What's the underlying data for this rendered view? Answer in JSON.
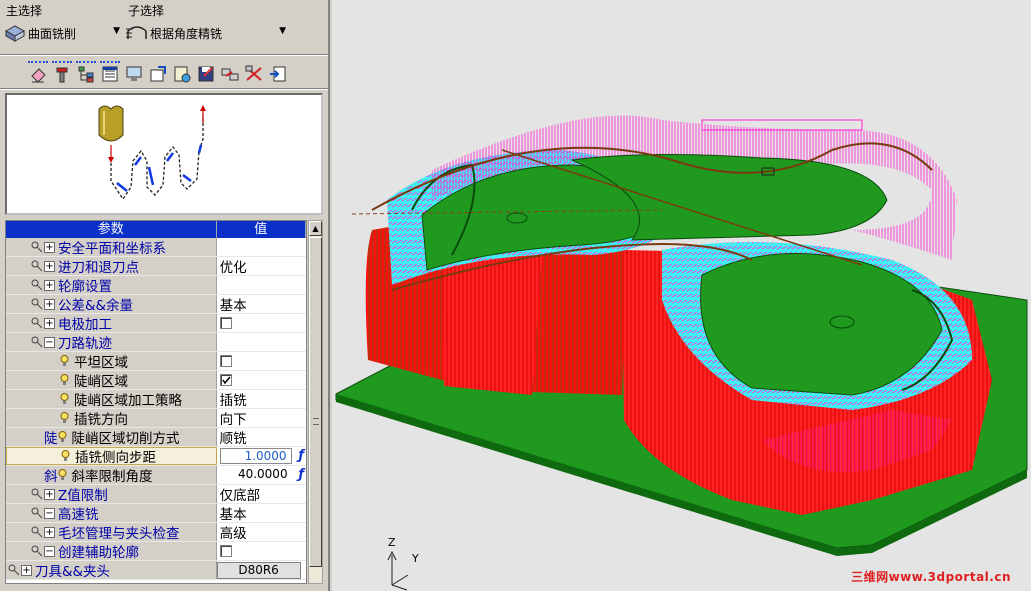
{
  "header": {
    "main_select_label": "主选择",
    "sub_select_label": "子选择",
    "main_select_value": "曲面铣削",
    "sub_select_value": "根据角度精铣"
  },
  "toolbar": {
    "icons": [
      "eraser-icon",
      "tool-icon",
      "tree-icon",
      "list-icon",
      "monitor-icon",
      "export-icon",
      "report-icon",
      "save-icon",
      "transfer-icon",
      "flow-icon",
      "import-icon"
    ]
  },
  "table": {
    "col_param": "参数",
    "col_value": "值",
    "rows": [
      {
        "label": "安全平面和坐标系",
        "value": ""
      },
      {
        "label": "进刀和退刀点",
        "value": "优化"
      },
      {
        "label": "轮廓设置",
        "value": ""
      },
      {
        "label": "公差&&余量",
        "value": "基本"
      },
      {
        "label": "电极加工",
        "value": ""
      },
      {
        "label": "刀路轨迹",
        "value": ""
      },
      {
        "label": "平坦区域",
        "value": ""
      },
      {
        "label": "陡峭区域",
        "value": ""
      },
      {
        "label": "陡峭区域加工策略",
        "value": "插铣"
      },
      {
        "label": "插铣方向",
        "value": "向下"
      },
      {
        "label": "陡峭区域切削方式",
        "value": "顺铣",
        "prefix": "陡"
      },
      {
        "label": "插铣侧向步距",
        "value": "1.0000"
      },
      {
        "label": "斜率限制角度",
        "value": "40.0000",
        "prefix": "斜"
      },
      {
        "label": "Z值限制",
        "value": "仅底部"
      },
      {
        "label": "高速铣",
        "value": "基本"
      },
      {
        "label": "毛坯管理与夹头检查",
        "value": "高级"
      },
      {
        "label": "创建辅助轮廓",
        "value": ""
      },
      {
        "label": "刀具&&夹头",
        "value": "D80R6"
      }
    ]
  },
  "checkboxes": {
    "electrode": false,
    "flat_area": false,
    "steep_area": true,
    "aux_contour": false
  },
  "fx_symbol": "ƒ",
  "viewport": {
    "axis_z": "Z",
    "axis_y": "Y",
    "watermark": "三维网www.3dportal.cn"
  },
  "colors": {
    "header_blue": "#0a30c8",
    "part_green": "#1f9a1f",
    "toolpath_red": "#ff1010",
    "toolpath_cyan": "#20e0e0",
    "toolpath_magenta": "#ff20d0"
  }
}
